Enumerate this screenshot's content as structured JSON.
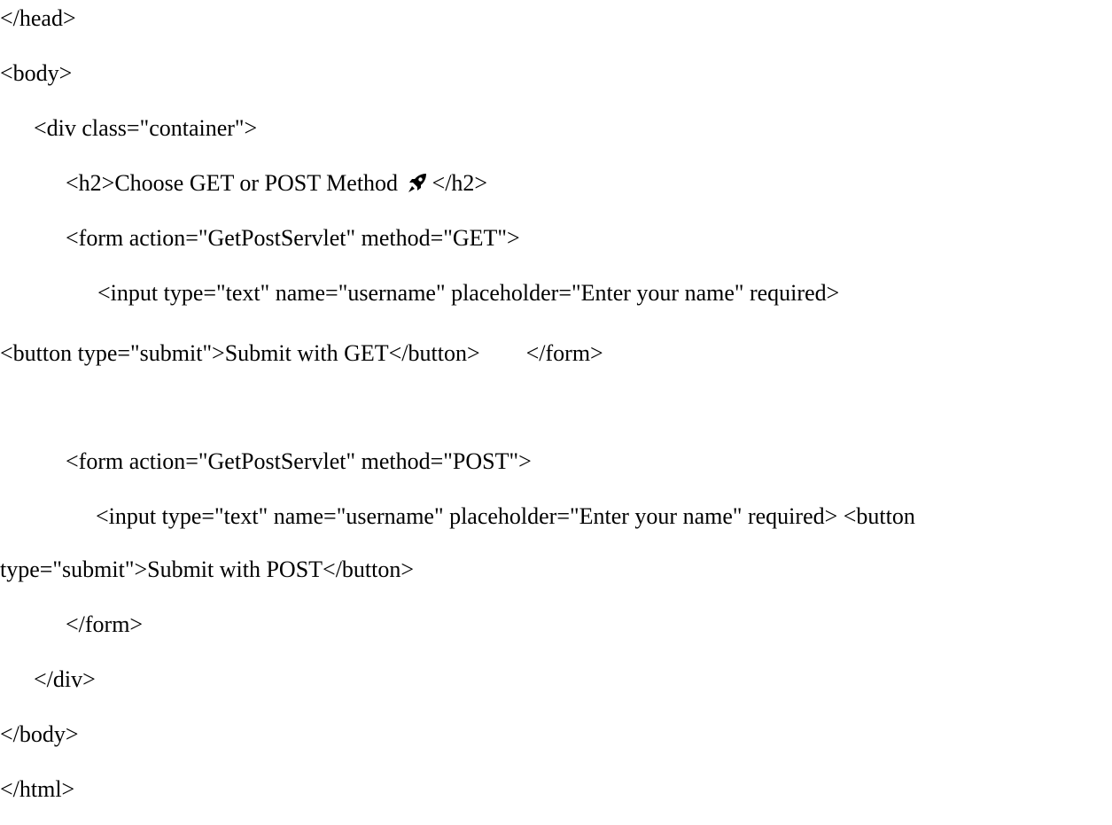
{
  "lines": {
    "head_close": "</head>",
    "body_open": "<body>",
    "div_open": "<div class=\"container\">",
    "h2_before": "<h2>Choose GET or POST Method ",
    "h2_after": "</h2>",
    "form_get_open": "<form action=\"GetPostServlet\" method=\"GET\">",
    "input_get": "<input type=\"text\" name=\"username\" placeholder=\"Enter your name\" required>",
    "button_get": "<button type=\"submit\">Submit with GET</button>",
    "form_get_close": "</form>",
    "form_post_open": "<form action=\"GetPostServlet\" method=\"POST\">",
    "input_post": "<input type=\"text\" name=\"username\" placeholder=\"Enter your name\" required> <button",
    "button_post": "type=\"submit\">Submit with POST</button>",
    "form_post_close": "</form>",
    "div_close": "</div>",
    "body_close": "</body>",
    "html_close": "</html>"
  },
  "icons": {
    "h2_emoji": "rocket-icon"
  }
}
